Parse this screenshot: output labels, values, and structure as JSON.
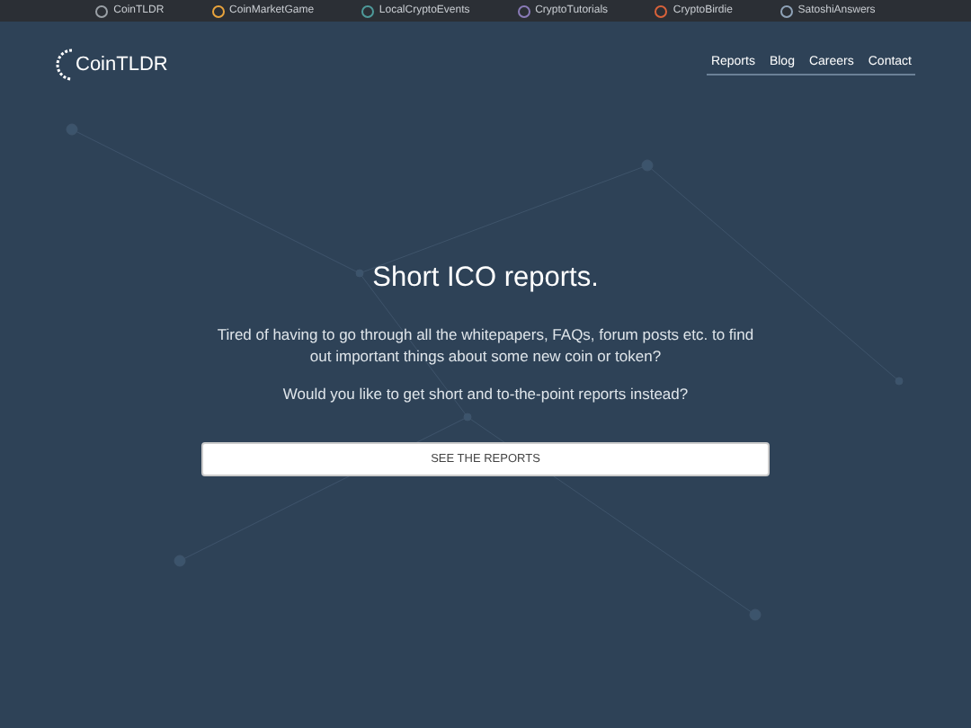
{
  "top_bar": [
    {
      "label": "CoinTLDR",
      "color": "#9aa0a6"
    },
    {
      "label": "CoinMarketGame",
      "color": "#e8a33c"
    },
    {
      "label": "LocalCryptoEvents",
      "color": "#4e9a9a"
    },
    {
      "label": "CryptoTutorials",
      "color": "#8a7bb8"
    },
    {
      "label": "CryptoBirdie",
      "color": "#d9623a"
    },
    {
      "label": "SatoshiAnswers",
      "color": "#8fa3b8"
    }
  ],
  "logo": {
    "text": "CoinTLDR"
  },
  "nav": [
    "Reports",
    "Blog",
    "Careers",
    "Contact"
  ],
  "hero": {
    "title": "Short ICO reports.",
    "paragraphs": [
      "Tired of having to go through all the whitepapers, FAQs, forum posts etc. to find out important things about some new coin or token?",
      "Would you like to get short and to-the-point reports instead?"
    ],
    "button": "SEE THE REPORTS"
  }
}
